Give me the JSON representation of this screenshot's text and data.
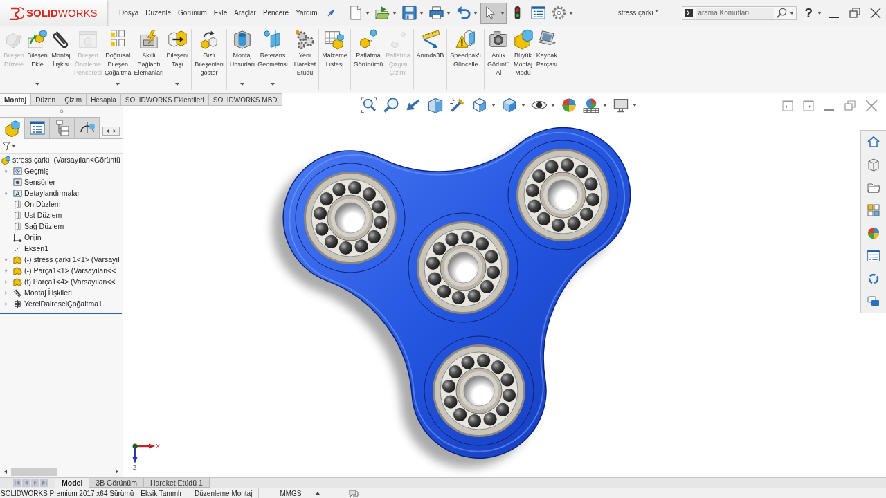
{
  "window": {
    "logo": "**SOLID**WORKS",
    "menu": [
      "Dosya",
      "Düzenle",
      "Görünüm",
      "Ekle",
      "Araçlar",
      "Pencere",
      "Yardım"
    ],
    "document_title": "stress çarkı *",
    "search": {
      "placeholder": "arama Komutları"
    },
    "help": "?"
  },
  "quick_access": [
    {
      "dropdown": true,
      "pressed": false
    },
    {
      "dropdown": true,
      "pressed": false
    },
    {
      "dropdown": true,
      "pressed": false
    },
    {
      "dropdown": true,
      "pressed": false
    },
    {
      "dropdown": true,
      "pressed": false
    },
    {
      "dropdown": true,
      "pressed": true
    },
    {
      "dropdown": false,
      "pressed": false
    },
    {
      "dropdown": false,
      "pressed": false
    },
    {
      "dropdown": true,
      "pressed": false
    }
  ],
  "ribbon": {
    "groups": [
      {
        "buttons": [
          {
            "label": "Bileşen\nDüzele",
            "disabled": true,
            "dropdown": false
          },
          {
            "label": "Bileşen\nEkle",
            "disabled": false,
            "dropdown": true
          },
          {
            "label": "Montaj\nİlişkisi",
            "disabled": false,
            "dropdown": false
          },
          {
            "label": "Bileşen\nÖnizleme\nPenceresi",
            "disabled": true,
            "dropdown": false
          },
          {
            "label": "Doğrusal\nBileşen\nÇoğaltma",
            "disabled": false,
            "dropdown": true
          },
          {
            "label": "Akıllı\nBağlantı\nElemanları",
            "disabled": false,
            "dropdown": false
          },
          {
            "label": "Bileşeni\nTaşı",
            "disabled": false,
            "dropdown": true
          }
        ]
      },
      {
        "buttons": [
          {
            "label": "Gizli\nBileşenleri\ngöster",
            "disabled": false,
            "dropdown": false
          }
        ]
      },
      {
        "buttons": [
          {
            "label": "Montaj\nUnsurları",
            "disabled": false,
            "dropdown": true
          },
          {
            "label": "Referans\nGeometrisi",
            "disabled": false,
            "dropdown": true
          }
        ]
      },
      {
        "buttons": [
          {
            "label": "Yeni\nHareket\nEtüdü",
            "disabled": false,
            "dropdown": false
          }
        ]
      },
      {
        "buttons": [
          {
            "label": "Malzeme\nListesi",
            "disabled": false,
            "dropdown": false
          }
        ]
      },
      {
        "buttons": [
          {
            "label": "Patlatma\nGörünümü",
            "disabled": false,
            "dropdown": false
          },
          {
            "label": "Patlatma\nÇizgisi\nÇizimi",
            "disabled": true,
            "dropdown": false
          }
        ]
      },
      {
        "buttons": [
          {
            "label": "Anında3B",
            "disabled": false,
            "dropdown": false
          }
        ]
      },
      {
        "buttons": [
          {
            "label": "Speedpak'ı\nGüncelle",
            "disabled": false,
            "dropdown": false
          }
        ]
      },
      {
        "buttons": [
          {
            "label": "Anlık\nGörüntü\nAl",
            "disabled": false,
            "dropdown": false
          },
          {
            "label": "Büyük\nMontaj\nModu",
            "disabled": false,
            "dropdown": false
          },
          {
            "label": "Kaynak\nParçası",
            "disabled": false,
            "dropdown": false
          }
        ]
      }
    ]
  },
  "command_tabs": [
    {
      "label": "Montaj",
      "selected": true
    },
    {
      "label": "Düzen",
      "selected": false
    },
    {
      "label": "Çizim",
      "selected": false
    },
    {
      "label": "Hesapla",
      "selected": false
    },
    {
      "label": "SOLIDWORKS Eklentileri",
      "selected": false
    },
    {
      "label": "SOLIDWORKS MBD",
      "selected": false
    }
  ],
  "view_toolbar": [
    {
      "dropdown": false
    },
    {
      "dropdown": false
    },
    {
      "dropdown": false
    },
    {
      "dropdown": false
    },
    {
      "dropdown": false
    },
    {
      "dropdown": true
    },
    {
      "dropdown": true
    },
    {
      "dropdown": true
    },
    {
      "dropdown": false
    },
    {
      "dropdown": true
    },
    {
      "dropdown": true
    }
  ],
  "feature_manager": {
    "tabs": [
      {
        "selected": true
      },
      {
        "selected": false
      },
      {
        "selected": false
      },
      {
        "selected": false
      }
    ],
    "tree": {
      "label": "stress çarkı  (Varsayılan<Görüntü",
      "children": [
        {
          "label": "Geçmiş",
          "kind": "history",
          "expanded": false
        },
        {
          "label": "Sensörler",
          "kind": "sensors"
        },
        {
          "label": "Detaylandırmalar",
          "kind": "annotations",
          "expanded": false
        },
        {
          "label": "Ön Düzlem",
          "kind": "plane"
        },
        {
          "label": "Üst Düzlem",
          "kind": "plane"
        },
        {
          "label": "Sağ Düzlem",
          "kind": "plane"
        },
        {
          "label": "Orijin",
          "kind": "origin"
        },
        {
          "label": "Eksen1",
          "kind": "axis"
        },
        {
          "label": "(-) stress çarkı 1<1> (Varsayıl",
          "kind": "component",
          "expanded": false
        },
        {
          "label": "(-) Parça1<1> (Varsayılan<<",
          "kind": "component",
          "expanded": false
        },
        {
          "label": "(f) Parça1<4> (Varsayılan<<",
          "kind": "component",
          "expanded": false
        },
        {
          "label": "Montaj İlişkileri",
          "kind": "mates",
          "expanded": false
        },
        {
          "label": "YerelDaireselÇoğaltma1",
          "kind": "pattern",
          "expanded": false
        }
      ]
    }
  },
  "triad": {
    "x_label": "X",
    "z_label": "Z"
  },
  "model_tabs": [
    {
      "label": "Model",
      "selected": true
    },
    {
      "label": "3B Görünüm",
      "selected": false
    },
    {
      "label": "Hareket Etüdü 1",
      "selected": false
    }
  ],
  "status_bar": {
    "product": "SOLIDWORKS Premium 2017 x64 Sürümü",
    "fields": [
      "Eksik Tanımlı",
      "Düzenleme Montaj"
    ],
    "units": "MMGS"
  }
}
